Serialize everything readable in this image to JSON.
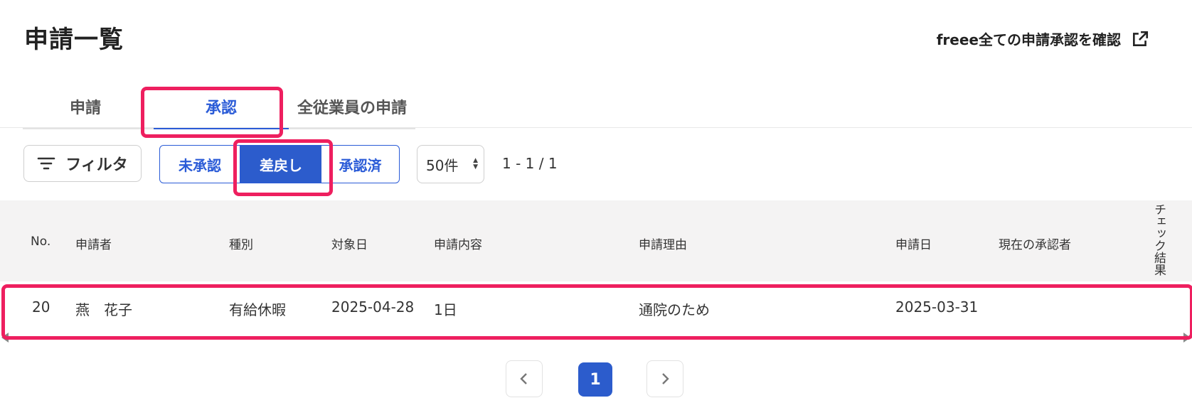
{
  "header": {
    "title": "申請一覧",
    "external_link_label": "freee全ての申請承認を確認"
  },
  "tabs": [
    {
      "label": "申請",
      "active": false
    },
    {
      "label": "承認",
      "active": true
    },
    {
      "label": "全従業員の申請",
      "active": false
    }
  ],
  "toolbar": {
    "filter_label": "フィルタ",
    "status_segments": [
      {
        "label": "未承認",
        "selected": false
      },
      {
        "label": "差戻し",
        "selected": true
      },
      {
        "label": "承認済",
        "selected": false
      }
    ],
    "per_page": "50件",
    "range_text": "1 - 1 / 1"
  },
  "table": {
    "columns": [
      "No.",
      "申請者",
      "種別",
      "対象日",
      "申請内容",
      "申請理由",
      "申請日",
      "現在の承認者",
      "チェック結果"
    ],
    "rows": [
      {
        "no": "20",
        "applicant": "燕　花子",
        "type": "有給休暇",
        "target_date": "2025-04-28",
        "content": "1日",
        "reason": "通院のため",
        "apply_date": "2025-03-31",
        "current_approver": "",
        "check_result": ""
      }
    ]
  },
  "pagination": {
    "current_page": "1"
  },
  "colors": {
    "accent": "#2a5bd7",
    "highlight": "#ee1f5f",
    "header_bg": "#f4f3f3"
  },
  "icons": [
    "external-link-icon",
    "filter-icon",
    "chevron-left-icon",
    "chevron-right-icon"
  ]
}
